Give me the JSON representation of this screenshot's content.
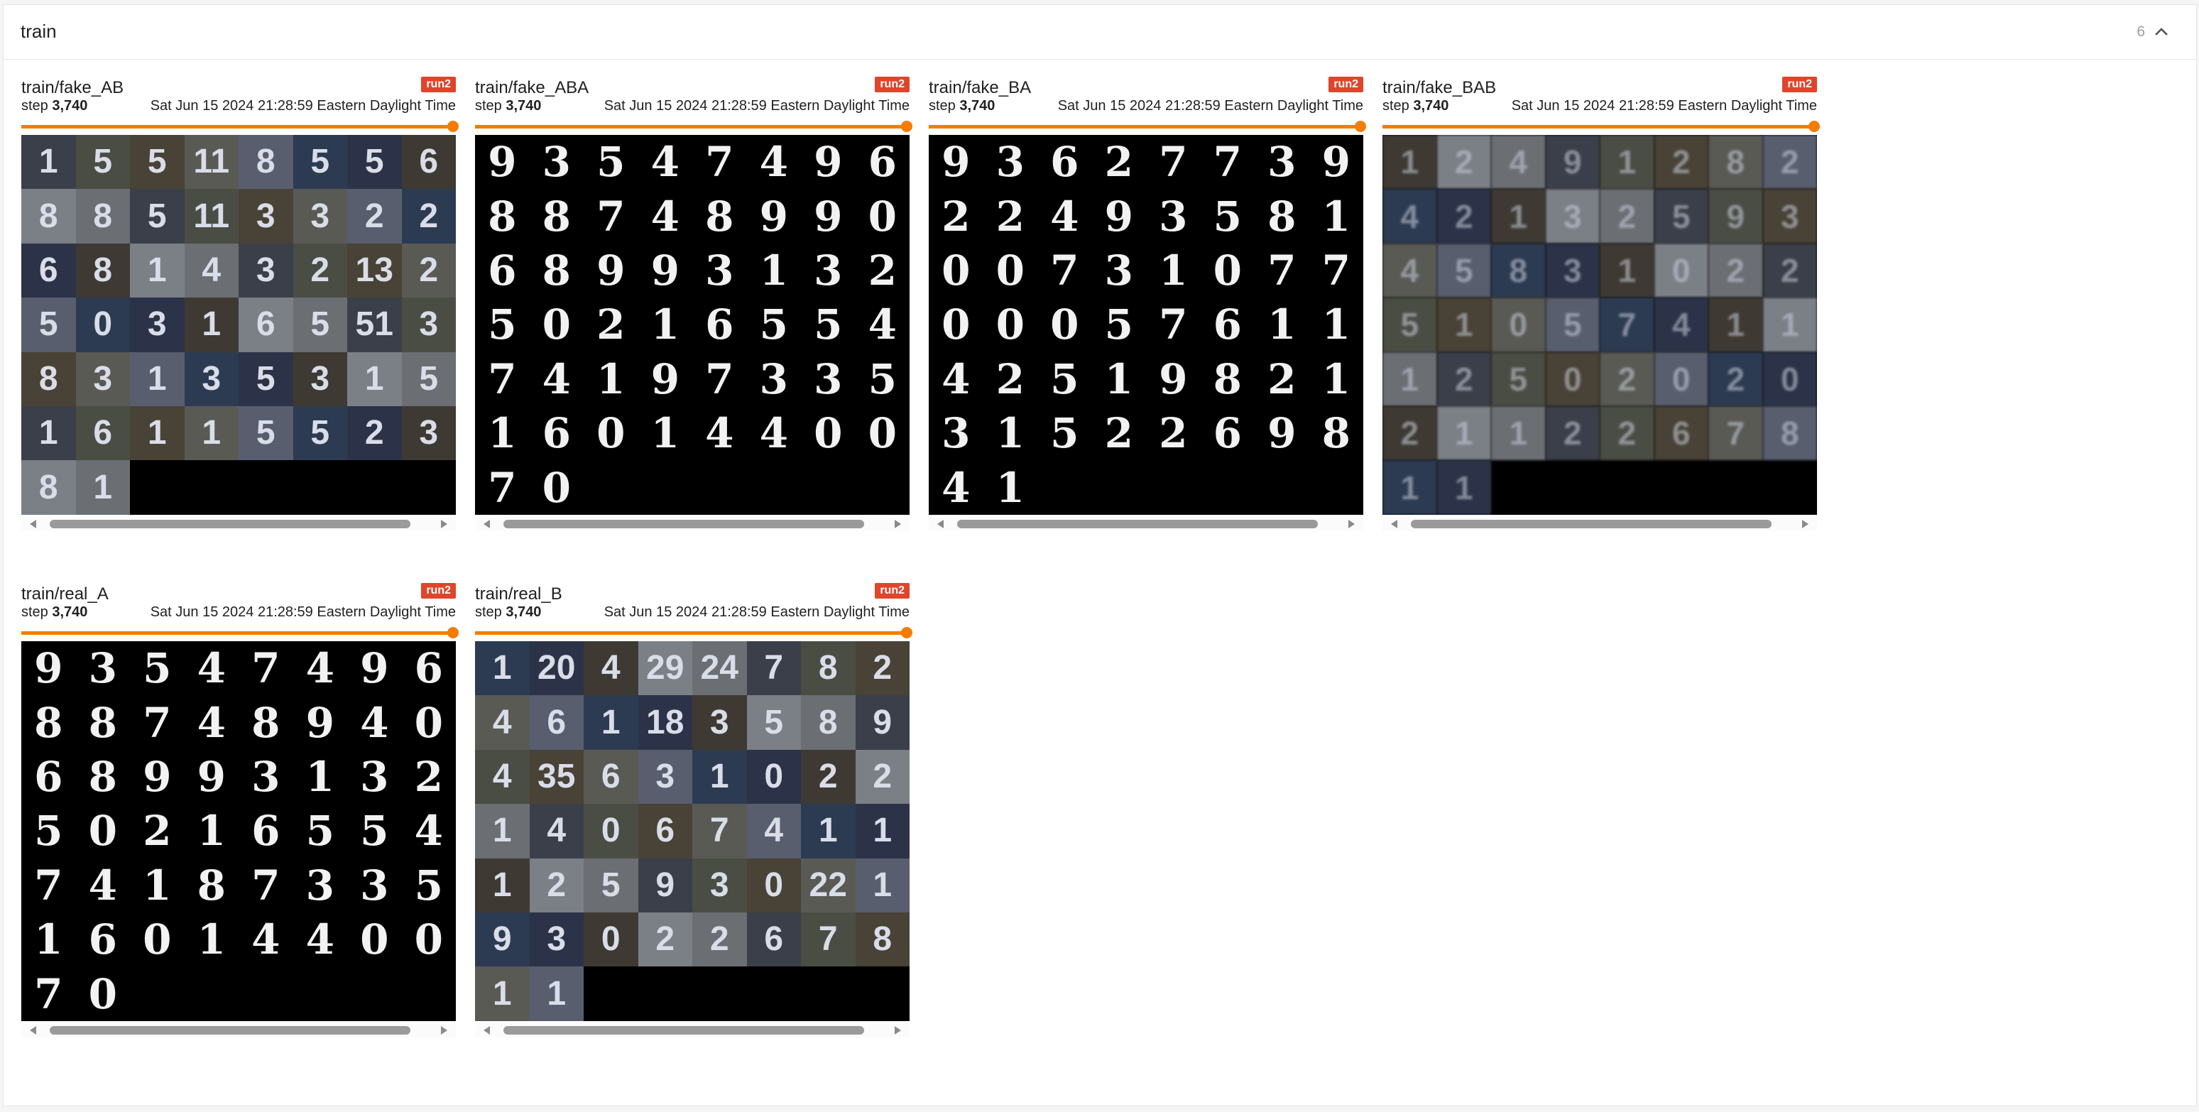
{
  "group": {
    "title": "train",
    "count": "6",
    "collapse_icon": "chevron-up-icon"
  },
  "cards": [
    {
      "tag": "train/fake_AB",
      "run": "run2",
      "step_label": "step",
      "step": "3,740",
      "timestamp": "Sat Jun 15 2024 21:28:59 Eastern Daylight Time",
      "slider_fraction": 1.0,
      "image_style": "svhn",
      "digits": [
        "1",
        "5",
        "5",
        "11",
        "8",
        "5",
        "5",
        "6",
        "8",
        "8",
        "5",
        "11",
        "3",
        "3",
        "2",
        "2",
        "6",
        "8",
        "1",
        "4",
        "3",
        "2",
        "13",
        "2",
        "5",
        "0",
        "3",
        "1",
        "6",
        "5",
        "51",
        "3",
        "8",
        "3",
        "1",
        "3",
        "5",
        "3",
        "1",
        "5",
        "1",
        "6",
        "1",
        "1",
        "5",
        "5",
        "2",
        "3",
        "8",
        "1"
      ]
    },
    {
      "tag": "train/fake_ABA",
      "run": "run2",
      "step_label": "step",
      "step": "3,740",
      "timestamp": "Sat Jun 15 2024 21:28:59 Eastern Daylight Time",
      "slider_fraction": 1.0,
      "image_style": "mnist",
      "digits": [
        "9",
        "3",
        "5",
        "4",
        "7",
        "4",
        "9",
        "6",
        "8",
        "8",
        "7",
        "4",
        "8",
        "9",
        "9",
        "0",
        "6",
        "8",
        "9",
        "9",
        "3",
        "1",
        "3",
        "2",
        "5",
        "0",
        "2",
        "1",
        "6",
        "5",
        "5",
        "4",
        "7",
        "4",
        "1",
        "9",
        "7",
        "3",
        "3",
        "5",
        "1",
        "6",
        "0",
        "1",
        "4",
        "4",
        "0",
        "0",
        "7",
        "0"
      ]
    },
    {
      "tag": "train/fake_BA",
      "run": "run2",
      "step_label": "step",
      "step": "3,740",
      "timestamp": "Sat Jun 15 2024 21:28:59 Eastern Daylight Time",
      "slider_fraction": 1.0,
      "image_style": "mnist",
      "digits": [
        "9",
        "3",
        "6",
        "2",
        "7",
        "7",
        "3",
        "9",
        "2",
        "2",
        "4",
        "9",
        "3",
        "5",
        "8",
        "1",
        "0",
        "0",
        "7",
        "3",
        "1",
        "0",
        "7",
        "7",
        "0",
        "0",
        "0",
        "5",
        "7",
        "6",
        "1",
        "1",
        "4",
        "2",
        "5",
        "1",
        "9",
        "8",
        "2",
        "1",
        "3",
        "1",
        "5",
        "2",
        "2",
        "6",
        "9",
        "8",
        "4",
        "1"
      ]
    },
    {
      "tag": "train/fake_BAB",
      "run": "run2",
      "step_label": "step",
      "step": "3,740",
      "timestamp": "Sat Jun 15 2024 21:28:59 Eastern Daylight Time",
      "slider_fraction": 1.0,
      "image_style": "blurry",
      "digits": [
        "1",
        "2",
        "4",
        "9",
        "1",
        "2",
        "8",
        "2",
        "4",
        "2",
        "1",
        "3",
        "2",
        "5",
        "9",
        "3",
        "4",
        "5",
        "8",
        "3",
        "1",
        "0",
        "2",
        "2",
        "5",
        "1",
        "0",
        "5",
        "7",
        "4",
        "1",
        "1",
        "1",
        "2",
        "5",
        "0",
        "2",
        "0",
        "2",
        "0",
        "2",
        "1",
        "1",
        "2",
        "2",
        "6",
        "7",
        "8",
        "1",
        "1"
      ]
    },
    {
      "tag": "train/real_A",
      "run": "run2",
      "step_label": "step",
      "step": "3,740",
      "timestamp": "Sat Jun 15 2024 21:28:59 Eastern Daylight Time",
      "slider_fraction": 1.0,
      "image_style": "mnist",
      "digits": [
        "9",
        "3",
        "5",
        "4",
        "7",
        "4",
        "9",
        "6",
        "8",
        "8",
        "7",
        "4",
        "8",
        "9",
        "4",
        "0",
        "6",
        "8",
        "9",
        "9",
        "3",
        "1",
        "3",
        "2",
        "5",
        "0",
        "2",
        "1",
        "6",
        "5",
        "5",
        "4",
        "7",
        "4",
        "1",
        "8",
        "7",
        "3",
        "3",
        "5",
        "1",
        "6",
        "0",
        "1",
        "4",
        "4",
        "0",
        "0",
        "7",
        "0"
      ]
    },
    {
      "tag": "train/real_B",
      "run": "run2",
      "step_label": "step",
      "step": "3,740",
      "timestamp": "Sat Jun 15 2024 21:28:59 Eastern Daylight Time",
      "slider_fraction": 1.0,
      "image_style": "svhn",
      "digits": [
        "1",
        "20",
        "4",
        "29",
        "24",
        "7",
        "8",
        "2",
        "4",
        "6",
        "1",
        "18",
        "3",
        "5",
        "8",
        "9",
        "4",
        "35",
        "6",
        "3",
        "1",
        "0",
        "2",
        "2",
        "1",
        "4",
        "0",
        "6",
        "7",
        "4",
        "1",
        "1",
        "1",
        "2",
        "5",
        "9",
        "3",
        "0",
        "22",
        "1",
        "9",
        "3",
        "0",
        "2",
        "2",
        "6",
        "7",
        "8",
        "1",
        "1"
      ]
    }
  ],
  "colors": {
    "accent": "#f57c00",
    "badge": "#e0452b"
  }
}
